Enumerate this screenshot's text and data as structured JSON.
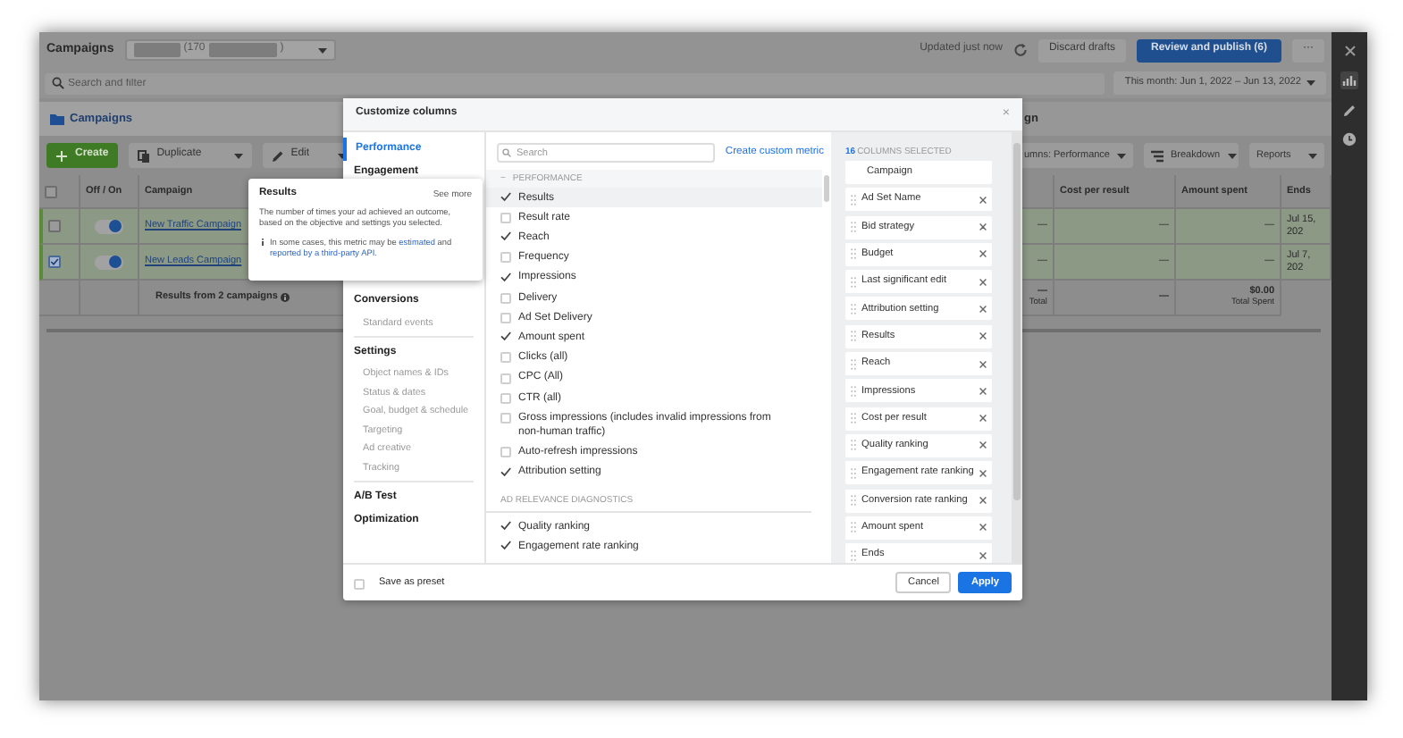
{
  "app_bar": {
    "title": "Campaigns",
    "account": {
      "visible_text": "(170",
      "closing": ")"
    },
    "updated": "Updated just now",
    "discard_button": "Discard drafts",
    "publish_button": "Review and publish (6)",
    "more_button": "···"
  },
  "filter_bar": {
    "search": {
      "placeholder": "Search and filter"
    },
    "date_range": "This month: Jun 1, 2022 – Jun 13, 2022"
  },
  "tabs": [
    {
      "label": "Campaigns",
      "selected": true
    },
    {
      "label": "gn",
      "selected": false
    }
  ],
  "toolbar": [
    {
      "label": "Create",
      "kind": "create"
    },
    {
      "label": "Duplicate",
      "kind": "duplicate"
    },
    {
      "label": "Edit",
      "kind": "edit"
    },
    {
      "label": "umns: Performance",
      "kind": "columns"
    },
    {
      "label": "Breakdown",
      "kind": "breakdown"
    },
    {
      "label": "Reports",
      "kind": "reports"
    }
  ],
  "table": {
    "header_checkbox": {
      "checked": false
    },
    "columns": [
      "Off / On",
      "Campaign",
      "Cost per result",
      "Amount spent",
      "Ends"
    ],
    "rows": [
      {
        "name": "New Traffic Campaign",
        "checked": false,
        "on": true,
        "cells": [
          "—",
          "—",
          "—",
          "Jul 15, 202"
        ]
      },
      {
        "name": "New Leads Campaign",
        "checked": true,
        "on": true,
        "cells": [
          "—",
          "—",
          "—",
          "Jul 7, 202"
        ]
      }
    ],
    "summary": {
      "label": "Results from 2 campaigns",
      "cells": [
        {
          "value": "—",
          "note": "Total"
        },
        {
          "value": "—"
        },
        {
          "value": "$0.00",
          "note": "Total Spent"
        }
      ]
    }
  },
  "tooltip": {
    "title": "Results",
    "link": "See more",
    "description": "The number of times your ad achieved an outcome, based on the objective and settings you selected.",
    "note": [
      {
        "text": "In some cases, this metric may be ",
        "link": false
      },
      {
        "text": "estimated",
        "link": true
      },
      {
        "text": " and ",
        "link": false
      },
      {
        "text": "reported by a third-party API.",
        "link": true
      }
    ]
  },
  "customize_columns": {
    "title": "Customize columns",
    "close": "×",
    "nav": [
      {
        "label": "Performance",
        "selected": true
      },
      {
        "label": "Engagement",
        "selected": false
      },
      {
        "label": "Conversions",
        "selected": false,
        "children": [
          {
            "label": "Standard events",
            "selected": false
          }
        ]
      },
      {
        "label": "Settings",
        "selected": false,
        "children": [
          {
            "label": "Object names & IDs",
            "selected": false
          },
          {
            "label": "Status & dates",
            "selected": false
          },
          {
            "label": "Goal, budget & schedule",
            "selected": false
          },
          {
            "label": "Targeting",
            "selected": false
          },
          {
            "label": "Ad creative",
            "selected": false
          },
          {
            "label": "Tracking",
            "selected": false
          }
        ]
      },
      {
        "label": "A/B Test",
        "selected": false
      },
      {
        "label": "Optimization",
        "selected": false
      }
    ],
    "search": {
      "placeholder": "Search"
    },
    "custom_metric_link": "Create custom metric",
    "sections": [
      {
        "title": "PERFORMANCE",
        "toggle": "−",
        "items": [
          {
            "label": "Results",
            "checked": true,
            "hovered": true
          },
          {
            "label": "Result rate",
            "checked": false,
            "hovered": false
          },
          {
            "label": "Reach",
            "checked": true,
            "hovered": false
          },
          {
            "label": "Frequency",
            "checked": false,
            "hovered": false
          },
          {
            "label": "Impressions",
            "checked": true,
            "hovered": false
          },
          {
            "label": "Delivery",
            "checked": false,
            "hovered": false
          },
          {
            "label": "Ad Set Delivery",
            "checked": false,
            "hovered": false
          },
          {
            "label": "Amount spent",
            "checked": true,
            "hovered": false
          },
          {
            "label": "Clicks (all)",
            "checked": false,
            "hovered": false
          },
          {
            "label": "CPC (All)",
            "checked": false,
            "hovered": false
          },
          {
            "label": "CTR (all)",
            "checked": false,
            "hovered": false
          },
          {
            "label": "Gross impressions (includes invalid impressions from non-human traffic)",
            "checked": false,
            "hovered": false
          },
          {
            "label": "Auto-refresh impressions",
            "checked": false,
            "hovered": false
          },
          {
            "label": "Attribution setting",
            "checked": true,
            "hovered": false
          }
        ]
      },
      {
        "title": "AD RELEVANCE DIAGNOSTICS",
        "items": [
          {
            "label": "Quality ranking",
            "checked": true,
            "hovered": false
          },
          {
            "label": "Engagement rate ranking",
            "checked": true,
            "hovered": false
          }
        ]
      }
    ],
    "selected_columns": {
      "count": "16",
      "label": "COLUMNS SELECTED",
      "items": [
        {
          "label": "Campaign",
          "removable": false
        },
        {
          "label": "Ad Set Name",
          "removable": true
        },
        {
          "label": "Bid strategy",
          "removable": true
        },
        {
          "label": "Budget",
          "removable": true
        },
        {
          "label": "Last significant edit",
          "removable": true
        },
        {
          "label": "Attribution setting",
          "removable": true
        },
        {
          "label": "Results",
          "removable": true
        },
        {
          "label": "Reach",
          "removable": true
        },
        {
          "label": "Impressions",
          "removable": true
        },
        {
          "label": "Cost per result",
          "removable": true
        },
        {
          "label": "Quality ranking",
          "removable": true
        },
        {
          "label": "Engagement rate ranking",
          "removable": true
        },
        {
          "label": "Conversion rate ranking",
          "removable": true
        },
        {
          "label": "Amount spent",
          "removable": true
        },
        {
          "label": "Ends",
          "removable": true
        }
      ]
    },
    "footer": {
      "preset": {
        "label": "Save as preset",
        "checked": false
      },
      "cancel": "Cancel",
      "apply": "Apply"
    }
  }
}
